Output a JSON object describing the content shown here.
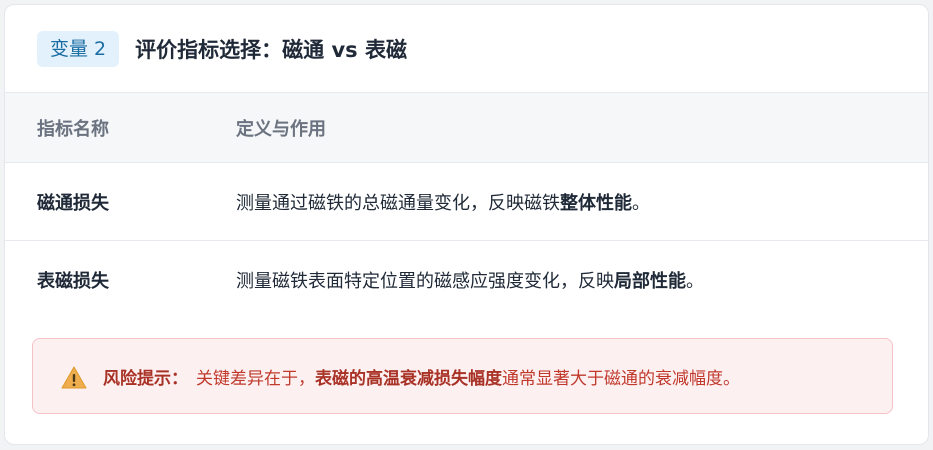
{
  "header": {
    "badge": "变量 2",
    "title": "评价指标选择：磁通 vs 表磁"
  },
  "table": {
    "columns": [
      "指标名称",
      "定义与作用"
    ],
    "rows": [
      {
        "name": "磁通损失",
        "definition_prefix": "测量通过磁铁的总磁通量变化，反映磁铁",
        "definition_bold": "整体性能",
        "definition_suffix": "。"
      },
      {
        "name": "表磁损失",
        "definition_prefix": "测量磁铁表面特定位置的磁感应强度变化，反映",
        "definition_bold": "局部性能",
        "definition_suffix": "。"
      }
    ]
  },
  "risk": {
    "icon": "warning-icon",
    "label": "风险提示：",
    "text_prefix": "关键差异在于，",
    "text_bold": "表磁的高温衰减损失幅度",
    "text_suffix": "通常显著大于磁通的衰减幅度。"
  },
  "colors": {
    "badge_bg": "#e2f1fb",
    "badge_text": "#1a6da4",
    "risk_bg": "#fdf0f1",
    "risk_border": "#f5c2c7",
    "risk_text": "#c0392b",
    "warning_icon": "#f0ad4e"
  }
}
